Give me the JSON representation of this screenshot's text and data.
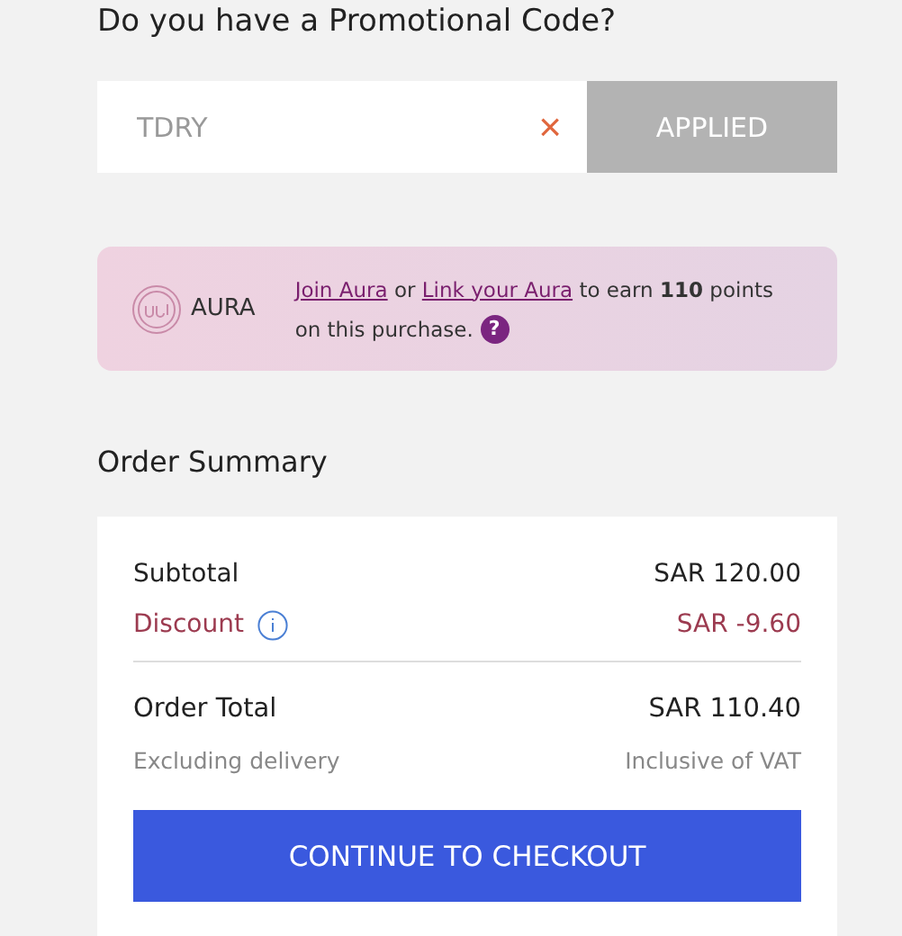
{
  "promo": {
    "heading": "Do you have a Promotional Code?",
    "value": "TDRY",
    "clear_icon": "×",
    "button": "APPLIED",
    "disabled": true
  },
  "aura": {
    "brand": "AURA",
    "join_link": "Join Aura",
    "connector": "or",
    "link_account": "Link your Aura",
    "message": "to earn **110** points on this purchase.",
    "help": "?"
  },
  "summary": {
    "title": "Order Summary",
    "rows": [
      {
        "label": "Subtotal",
        "value": "SAR 120.00",
        "kind": "normal",
        "info": false
      },
      {
        "label": "Discount",
        "value": "SAR -9.60",
        "kind": "discount",
        "info": true
      }
    ],
    "total": {
      "label": "Order Total",
      "value": "SAR 110.40"
    },
    "notes": {
      "left": "Excluding delivery",
      "right": "Inclusive of VAT"
    },
    "button": "CONTINUE TO CHECKOUT"
  }
}
